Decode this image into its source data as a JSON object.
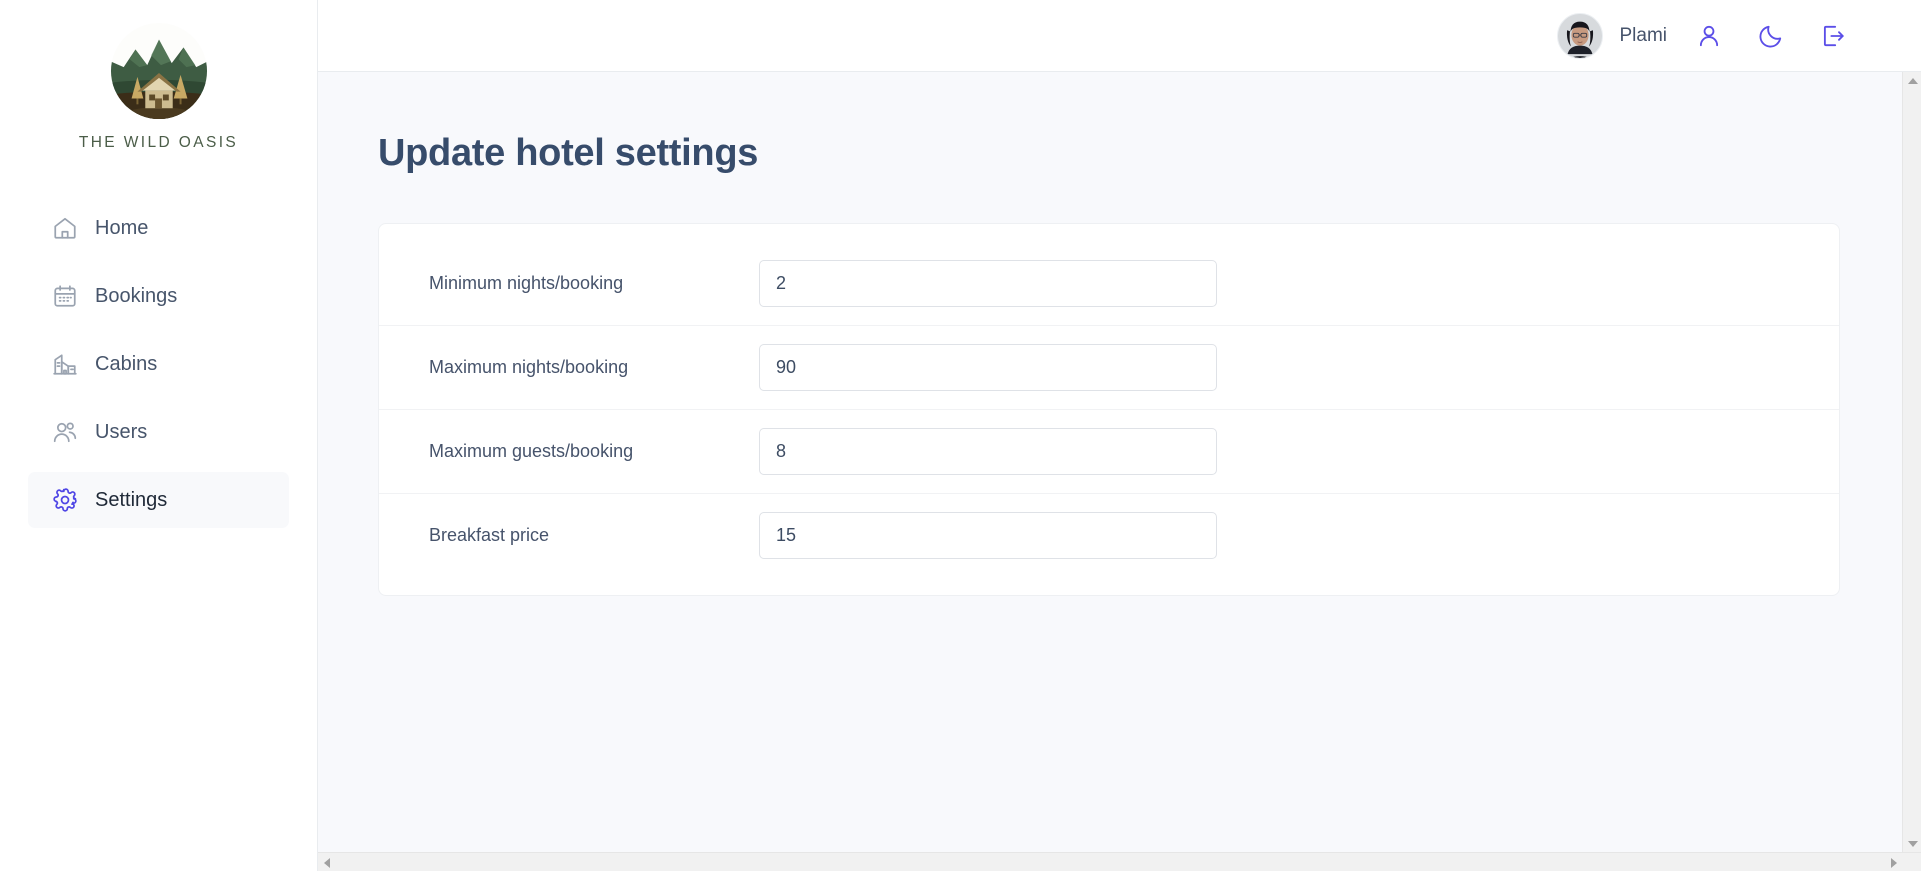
{
  "brand": {
    "name": "THE WILD OASIS",
    "logo_icon": "mountain-cabin-logo"
  },
  "sidebar": {
    "items": [
      {
        "label": "Home",
        "icon": "home-icon",
        "active": false
      },
      {
        "label": "Bookings",
        "icon": "calendar-icon",
        "active": false
      },
      {
        "label": "Cabins",
        "icon": "cabin-icon",
        "active": false
      },
      {
        "label": "Users",
        "icon": "users-icon",
        "active": false
      },
      {
        "label": "Settings",
        "icon": "gear-icon",
        "active": true
      }
    ]
  },
  "header": {
    "user_name": "Plami",
    "avatar_alt": "user-avatar",
    "actions": [
      {
        "name": "account-button",
        "icon": "user-icon"
      },
      {
        "name": "dark-mode-toggle",
        "icon": "moon-icon"
      },
      {
        "name": "logout-button",
        "icon": "logout-icon"
      }
    ]
  },
  "main": {
    "title": "Update hotel settings",
    "form_rows": [
      {
        "label": "Minimum nights/booking",
        "value": "2",
        "name": "min-nights-input"
      },
      {
        "label": "Maximum nights/booking",
        "value": "90",
        "name": "max-nights-input"
      },
      {
        "label": "Maximum guests/booking",
        "value": "8",
        "name": "max-guests-input"
      },
      {
        "label": "Breakfast price",
        "value": "15",
        "name": "breakfast-price-input"
      }
    ]
  },
  "colors": {
    "accent": "#5b4ee8",
    "title": "#374c6b",
    "text": "#46536b",
    "content_bg": "#f8f9fc",
    "logo_green": "#4b5d48"
  }
}
